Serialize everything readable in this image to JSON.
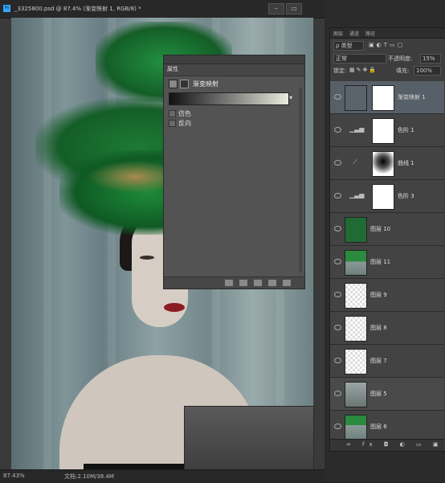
{
  "document": {
    "tab_title": "_3325800.psd @ 87.4% (渐变映射 1, RGB/8) *",
    "app_icon": "Ps"
  },
  "status": {
    "zoom": "87.43%",
    "doc_info": "文档:2.10M/38.4M"
  },
  "properties": {
    "tab_label": "属性",
    "adjustment_title": "渐变映射",
    "checkbox_dither": "仿色",
    "checkbox_reverse": "反向"
  },
  "layers_panel": {
    "tabs": [
      "图层",
      "通道",
      "路径"
    ],
    "filter_label": "ρ 类型",
    "blend_mode": "正常",
    "opacity_label": "不透明度:",
    "opacity_value": "15%",
    "lock_label": "锁定:",
    "fill_label": "填充:",
    "fill_value": "100%",
    "layers": [
      {
        "name": "渐变映射 1",
        "kind": "gradient-map",
        "selected": true
      },
      {
        "name": "色阶 1",
        "kind": "levels"
      },
      {
        "name": "曲线 1",
        "kind": "curves"
      },
      {
        "name": "色阶 3",
        "kind": "levels"
      },
      {
        "name": "图层 10",
        "kind": "fill"
      },
      {
        "name": "图层 11",
        "kind": "photo"
      },
      {
        "name": "图层 9",
        "kind": "transparent"
      },
      {
        "name": "图层 8",
        "kind": "transparent"
      },
      {
        "name": "图层 7",
        "kind": "transparent"
      },
      {
        "name": "图层 5",
        "kind": "photo-gray"
      },
      {
        "name": "图层 6",
        "kind": "photo"
      }
    ]
  },
  "colors": {
    "fill_layer_green": "#1f6b33",
    "selected_row": "#576068"
  }
}
